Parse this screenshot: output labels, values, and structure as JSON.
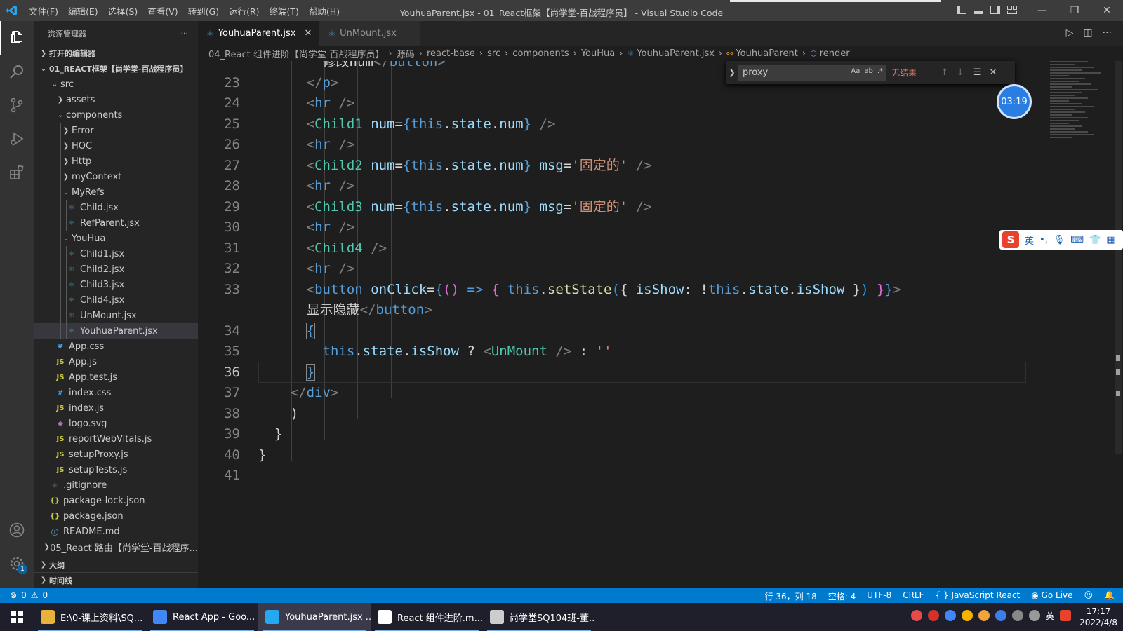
{
  "window": {
    "title": "YouhuaParent.jsx - 01_React框架【尚学堂-百战程序员】 - Visual Studio Code",
    "menu": [
      "文件(F)",
      "编辑(E)",
      "选择(S)",
      "查看(V)",
      "转到(G)",
      "运行(R)",
      "终端(T)",
      "帮助(H)"
    ]
  },
  "sidebar": {
    "title": "资源管理器",
    "open_editors": "打开的编辑器",
    "project": "01_REACT框架【尚学堂-百战程序员】",
    "tree": [
      {
        "label": "src",
        "depth": 1,
        "type": "folder-open"
      },
      {
        "label": "assets",
        "depth": 2,
        "type": "folder"
      },
      {
        "label": "components",
        "depth": 2,
        "type": "folder-open"
      },
      {
        "label": "Error",
        "depth": 3,
        "type": "folder"
      },
      {
        "label": "HOC",
        "depth": 3,
        "type": "folder"
      },
      {
        "label": "Http",
        "depth": 3,
        "type": "folder"
      },
      {
        "label": "myContext",
        "depth": 3,
        "type": "folder"
      },
      {
        "label": "MyRefs",
        "depth": 3,
        "type": "folder-open"
      },
      {
        "label": "Child.jsx",
        "depth": 4,
        "type": "react"
      },
      {
        "label": "RefParent.jsx",
        "depth": 4,
        "type": "react"
      },
      {
        "label": "YouHua",
        "depth": 3,
        "type": "folder-open"
      },
      {
        "label": "Child1.jsx",
        "depth": 4,
        "type": "react"
      },
      {
        "label": "Child2.jsx",
        "depth": 4,
        "type": "react"
      },
      {
        "label": "Child3.jsx",
        "depth": 4,
        "type": "react"
      },
      {
        "label": "Child4.jsx",
        "depth": 4,
        "type": "react"
      },
      {
        "label": "UnMount.jsx",
        "depth": 4,
        "type": "react"
      },
      {
        "label": "YouhuaParent.jsx",
        "depth": 4,
        "type": "react",
        "selected": true
      },
      {
        "label": "App.css",
        "depth": 2,
        "type": "css"
      },
      {
        "label": "App.js",
        "depth": 2,
        "type": "js"
      },
      {
        "label": "App.test.js",
        "depth": 2,
        "type": "js"
      },
      {
        "label": "index.css",
        "depth": 2,
        "type": "css"
      },
      {
        "label": "index.js",
        "depth": 2,
        "type": "js"
      },
      {
        "label": "logo.svg",
        "depth": 2,
        "type": "svg"
      },
      {
        "label": "reportWebVitals.js",
        "depth": 2,
        "type": "js"
      },
      {
        "label": "setupProxy.js",
        "depth": 2,
        "type": "js"
      },
      {
        "label": "setupTests.js",
        "depth": 2,
        "type": "js"
      },
      {
        "label": ".gitignore",
        "depth": 1,
        "type": "git"
      },
      {
        "label": "package-lock.json",
        "depth": 1,
        "type": "json"
      },
      {
        "label": "package.json",
        "depth": 1,
        "type": "json"
      },
      {
        "label": "README.md",
        "depth": 1,
        "type": "info"
      },
      {
        "label": "05_React 路由【尚学堂-百战程序...",
        "depth": 0,
        "type": "folder"
      }
    ],
    "outline": "大纲",
    "timeline": "时间线"
  },
  "tabs": [
    {
      "label": "YouhuaParent.jsx",
      "active": true
    },
    {
      "label": "UnMount.jsx",
      "active": false
    }
  ],
  "breadcrumb": [
    "04_React 组件进阶【尚学堂-百战程序员】",
    "源码",
    "react-base",
    "src",
    "components",
    "YouHua",
    "YouhuaParent.jsx",
    "YouhuaParent",
    "render"
  ],
  "find": {
    "query": "proxy",
    "result": "无结果",
    "opt_case": "Aa",
    "opt_word": "ab",
    "opt_regex": ".*"
  },
  "code_lines": [
    {
      "n": "",
      "html": "<span class='t-txt'>        修改num</span><span class='t-tag'>&lt;/</span><span class='t-el'>button</span><span class='t-tag'>&gt;</span>"
    },
    {
      "n": "23",
      "html": "      <span class='t-tag'>&lt;/</span><span class='t-el'>p</span><span class='t-tag'>&gt;</span>"
    },
    {
      "n": "24",
      "html": "      <span class='t-tag'>&lt;</span><span class='t-el'>hr</span> <span class='t-tag'>/&gt;</span>"
    },
    {
      "n": "25",
      "html": "      <span class='t-tag'>&lt;</span><span class='t-comp'>Child1</span> <span class='t-attr'>num</span><span class='t-txt'>=</span><span class='t-kw'>{</span><span class='t-kw'>this</span><span class='t-txt'>.</span><span class='t-prop'>state</span><span class='t-txt'>.</span><span class='t-prop'>num</span><span class='t-kw'>}</span> <span class='t-tag'>/&gt;</span>"
    },
    {
      "n": "26",
      "html": "      <span class='t-tag'>&lt;</span><span class='t-el'>hr</span> <span class='t-tag'>/&gt;</span>"
    },
    {
      "n": "27",
      "html": "      <span class='t-tag'>&lt;</span><span class='t-comp'>Child2</span> <span class='t-attr'>num</span><span class='t-txt'>=</span><span class='t-kw'>{</span><span class='t-kw'>this</span><span class='t-txt'>.</span><span class='t-prop'>state</span><span class='t-txt'>.</span><span class='t-prop'>num</span><span class='t-kw'>}</span> <span class='t-attr'>msg</span><span class='t-txt'>=</span><span class='t-str'>'固定的'</span> <span class='t-tag'>/&gt;</span>"
    },
    {
      "n": "28",
      "html": "      <span class='t-tag'>&lt;</span><span class='t-el'>hr</span> <span class='t-tag'>/&gt;</span>"
    },
    {
      "n": "29",
      "html": "      <span class='t-tag'>&lt;</span><span class='t-comp'>Child3</span> <span class='t-attr'>num</span><span class='t-txt'>=</span><span class='t-kw'>{</span><span class='t-kw'>this</span><span class='t-txt'>.</span><span class='t-prop'>state</span><span class='t-txt'>.</span><span class='t-prop'>num</span><span class='t-kw'>}</span> <span class='t-attr'>msg</span><span class='t-txt'>=</span><span class='t-str'>'固定的'</span> <span class='t-tag'>/&gt;</span>"
    },
    {
      "n": "30",
      "html": "      <span class='t-tag'>&lt;</span><span class='t-el'>hr</span> <span class='t-tag'>/&gt;</span>"
    },
    {
      "n": "31",
      "html": "      <span class='t-tag'>&lt;</span><span class='t-comp'>Child4</span> <span class='t-tag'>/&gt;</span>"
    },
    {
      "n": "32",
      "html": "      <span class='t-tag'>&lt;</span><span class='t-el'>hr</span> <span class='t-tag'>/&gt;</span>"
    },
    {
      "n": "33",
      "html": "      <span class='t-tag'>&lt;</span><span class='t-el'>button</span> <span class='t-attr'>onClick</span><span class='t-txt'>=</span><span class='t-kw'>{</span><span class='t-br2'>()</span> <span class='t-kw'>=&gt;</span> <span class='t-br2'>{</span> <span class='t-kw'>this</span><span class='t-txt'>.</span><span class='t-fn'>setState</span><span class='t-br3'>(</span><span class='t-br'>{</span> <span class='t-prop'>isShow</span><span class='t-txt'>: !</span><span class='t-kw'>this</span><span class='t-txt'>.</span><span class='t-prop'>state</span><span class='t-txt'>.</span><span class='t-prop'>isShow</span> <span class='t-br'>}</span><span class='t-br3'>)</span> <span class='t-br2'>}</span><span class='t-kw'>}</span><span class='t-tag'>&gt;</span>"
    },
    {
      "n": "",
      "html": "      <span class='t-txt'>显示隐藏</span><span class='t-tag'>&lt;/</span><span class='t-el'>button</span><span class='t-tag'>&gt;</span>"
    },
    {
      "n": "34",
      "html": "      <span class='t-kw t-bracehl'>{</span>"
    },
    {
      "n": "35",
      "html": "        <span class='t-kw'>this</span><span class='t-txt'>.</span><span class='t-prop'>state</span><span class='t-txt'>.</span><span class='t-prop'>isShow</span> <span class='t-txt'>?</span> <span class='t-tag'>&lt;</span><span class='t-comp'>UnMount</span> <span class='t-tag'>/&gt;</span> <span class='t-txt'>:</span> <span class='t-str'>''</span>"
    },
    {
      "n": "36",
      "html": "      <span class='t-kw t-bracehl'>}</span>",
      "current": true
    },
    {
      "n": "37",
      "html": "    <span class='t-tag'>&lt;/</span><span class='t-el'>div</span><span class='t-tag'>&gt;</span>"
    },
    {
      "n": "38",
      "html": "  <span class='t-br'>)</span>"
    },
    {
      "n": "39",
      "html": "<span class='t-br'>}</span>",
      "pre": "  "
    },
    {
      "n": "40",
      "html": "<span class='t-br'>}</span>"
    },
    {
      "n": "41",
      "html": ""
    }
  ],
  "timer": "03:19",
  "ime": {
    "logo": "S",
    "lang": "英"
  },
  "status": {
    "errors": "0",
    "warnings": "0",
    "position": "行 36，列 18",
    "spaces": "空格: 4",
    "encoding": "UTF-8",
    "eol": "CRLF",
    "language": "JavaScript React",
    "golive": "Go Live"
  },
  "taskbar": {
    "tasks": [
      {
        "label": "E:\\0-课上资料\\SQ...",
        "color": "#e8b33a"
      },
      {
        "label": "React App - Goo...",
        "color": "#4285f4"
      },
      {
        "label": "YouhuaParent.jsx ...",
        "color": "#23a9f2",
        "active": true
      },
      {
        "label": "React 组件进阶.m...",
        "color": "#ffffff"
      },
      {
        "label": "尚学堂SQ104班-董...",
        "color": "#cccccc"
      }
    ],
    "ime_lang": "英",
    "time": "17:17",
    "date": "2022/4/8"
  },
  "colors": {
    "accent": "#007acc",
    "find_no_result": "#f48771"
  }
}
